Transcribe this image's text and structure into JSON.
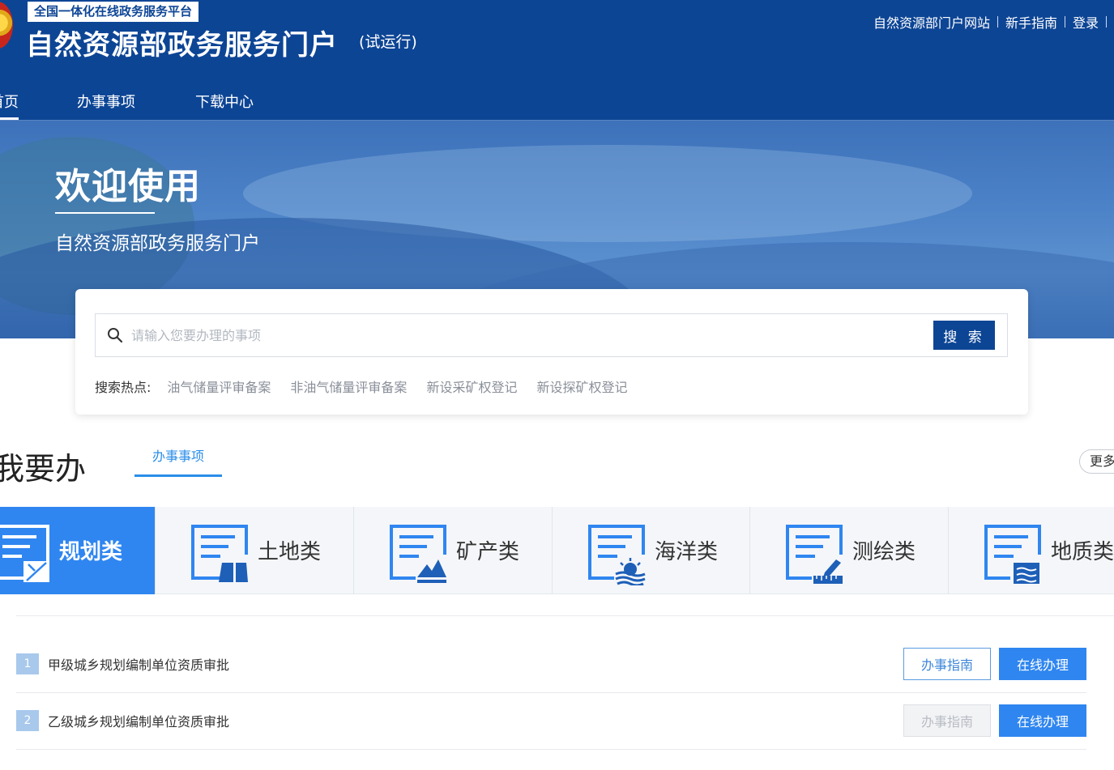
{
  "header": {
    "platform_tag": "全国一体化在线政务服务平台",
    "title": "自然资源部政务服务门户",
    "trial": "(试运行)",
    "links": [
      "自然资源部门户网站",
      "新手指南",
      "登录"
    ]
  },
  "nav": {
    "items": [
      "首页",
      "办事事项",
      "下载中心"
    ]
  },
  "banner": {
    "welcome": "欢迎使用",
    "subtitle": "自然资源部政务服务门户"
  },
  "search": {
    "placeholder": "请输入您要办理的事项",
    "button": "搜 索",
    "hot_label": "搜索热点:",
    "hot_items": [
      "油气储量评审备案",
      "非油气储量评审备案",
      "新设采矿权登记",
      "新设探矿权登记"
    ]
  },
  "section": {
    "title": "我要办",
    "tab": "办事事项",
    "more": "更多"
  },
  "categories": [
    {
      "label": "规划类",
      "icon": "planning-icon",
      "active": true
    },
    {
      "label": "土地类",
      "icon": "land-icon"
    },
    {
      "label": "矿产类",
      "icon": "mineral-icon"
    },
    {
      "label": "海洋类",
      "icon": "ocean-icon"
    },
    {
      "label": "测绘类",
      "icon": "surveying-icon"
    },
    {
      "label": "地质类",
      "icon": "geology-icon"
    }
  ],
  "items": [
    {
      "num": "1",
      "title": "甲级城乡规划编制单位资质审批",
      "guide": "办事指南",
      "online": "在线办理",
      "guide_enabled": true
    },
    {
      "num": "2",
      "title": "乙级城乡规划编制单位资质审批",
      "guide": "办事指南",
      "online": "在线办理",
      "guide_enabled": false
    }
  ],
  "colors": {
    "header_bg": "#0d4595",
    "accent": "#2f86f0",
    "tab_accent": "#2a8ee8"
  }
}
